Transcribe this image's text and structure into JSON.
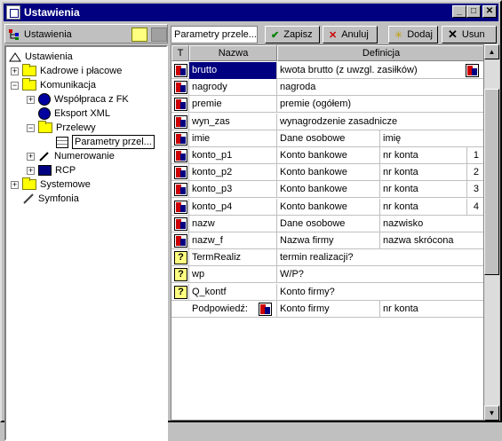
{
  "window": {
    "title": "Ustawienia"
  },
  "left_header": {
    "label": "Ustawienia"
  },
  "tree": {
    "root": "Ustawienia",
    "items": [
      {
        "label": "Kadrowe i płacowe"
      },
      {
        "label": "Komunikacja"
      },
      {
        "label": "Współpraca z FK"
      },
      {
        "label": "Eksport XML"
      },
      {
        "label": "Przelewy"
      },
      {
        "label": "Parametry przel..."
      },
      {
        "label": "Numerowanie"
      },
      {
        "label": "RCP"
      },
      {
        "label": "Systemowe"
      },
      {
        "label": "Symfonia"
      }
    ]
  },
  "toolbar": {
    "field_value": "Parametry przele...",
    "save_label": "Zapisz",
    "cancel_label": "Anuluj",
    "add_label": "Dodaj",
    "delete_label": "Usun"
  },
  "grid": {
    "headers": {
      "t": "T",
      "nazwa": "Nazwa",
      "definicja": "Definicja"
    },
    "rows": [
      {
        "icon": "red-blue-icon",
        "nazwa": "brutto",
        "def1": "kwota brutto (z uwzgl. zasiłków)",
        "def2": "",
        "num": "",
        "selected": true
      },
      {
        "icon": "red-blue-icon",
        "nazwa": "nagrody",
        "def1": "nagroda",
        "def2": "",
        "num": ""
      },
      {
        "icon": "red-blue-icon",
        "nazwa": "premie",
        "def1": "premie (ogółem)",
        "def2": "",
        "num": ""
      },
      {
        "icon": "red-blue-icon",
        "nazwa": "wyn_zas",
        "def1": "wynagrodzenie zasadnicze",
        "def2": "",
        "num": ""
      },
      {
        "icon": "red-blue-icon",
        "nazwa": "imie",
        "def1": "Dane osobowe",
        "def2": "imię",
        "num": ""
      },
      {
        "icon": "red-blue-icon",
        "nazwa": "konto_p1",
        "def1": "Konto bankowe",
        "def2": "nr konta",
        "num": "1"
      },
      {
        "icon": "red-blue-icon",
        "nazwa": "konto_p2",
        "def1": "Konto bankowe",
        "def2": "nr konta",
        "num": "2"
      },
      {
        "icon": "red-blue-icon",
        "nazwa": "konto_p3",
        "def1": "Konto bankowe",
        "def2": "nr konta",
        "num": "3"
      },
      {
        "icon": "red-blue-icon",
        "nazwa": "konto_p4",
        "def1": "Konto bankowe",
        "def2": "nr konta",
        "num": "4"
      },
      {
        "icon": "red-blue-icon",
        "nazwa": "nazw",
        "def1": "Dane osobowe",
        "def2": "nazwisko",
        "num": ""
      },
      {
        "icon": "red-blue-icon",
        "nazwa": "nazw_f",
        "def1": "Nazwa firmy",
        "def2": "nazwa skrócona",
        "num": ""
      },
      {
        "icon": "question-icon",
        "nazwa": "TermRealiz",
        "def1": "termin realizacji?",
        "def2": "",
        "num": ""
      },
      {
        "icon": "question-icon",
        "nazwa": "wp",
        "def1": "W/P?",
        "def2": "",
        "num": ""
      },
      {
        "icon": "question-icon",
        "nazwa": "Q_kontf",
        "def1": "Konto firmy?",
        "def2": "",
        "num": ""
      }
    ],
    "hint": {
      "label": "Podpowiedź:",
      "def1": "Konto firmy",
      "def2": "nr konta"
    }
  }
}
